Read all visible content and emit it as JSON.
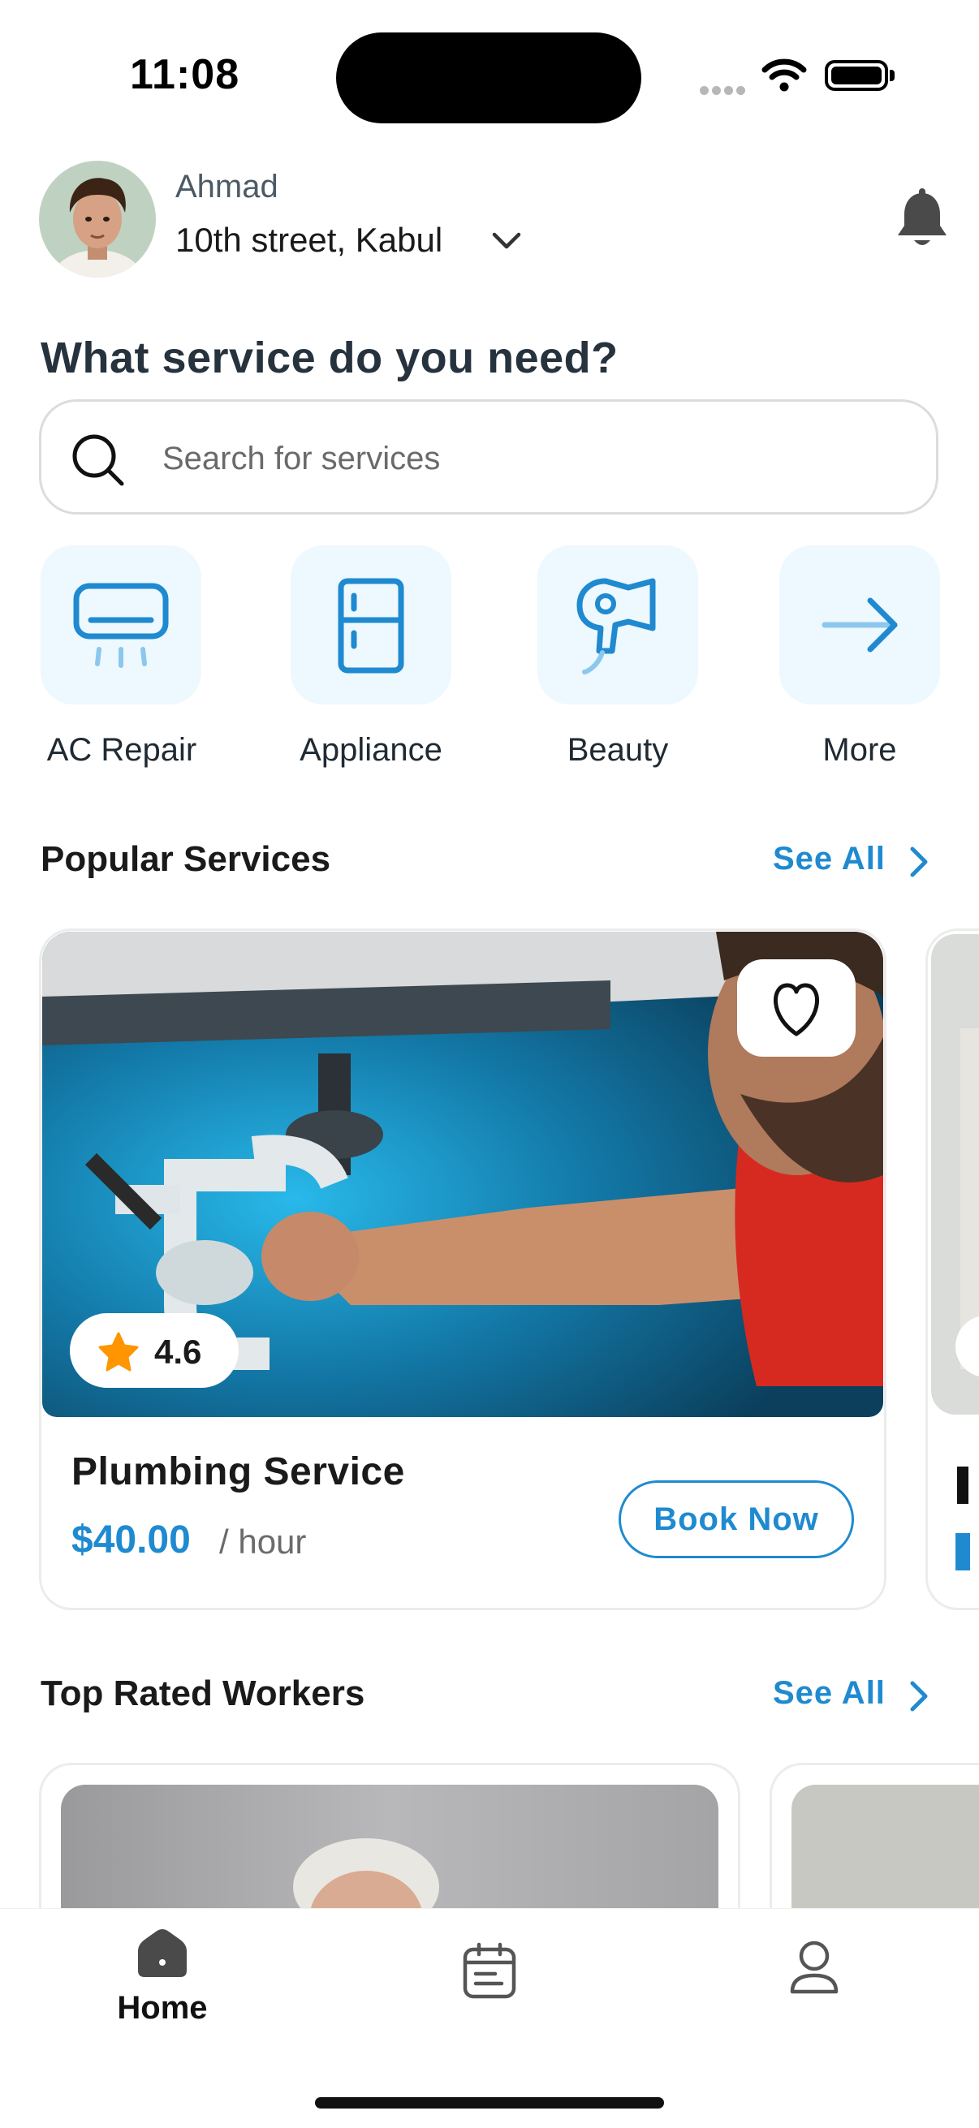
{
  "status_bar": {
    "time": "11:08"
  },
  "header": {
    "user_name": "Ahmad",
    "location": "10th street, Kabul"
  },
  "headline": "What service do you need?",
  "search": {
    "placeholder": "Search for services"
  },
  "categories": [
    {
      "label": "AC Repair",
      "icon": "ac-icon"
    },
    {
      "label": "Appliance",
      "icon": "fridge-icon"
    },
    {
      "label": "Beauty",
      "icon": "hair-dryer-icon"
    },
    {
      "label": "More",
      "icon": "arrow-right-icon"
    }
  ],
  "popular": {
    "title": "Popular Services",
    "see_all": "See All",
    "cards": [
      {
        "rating": "4.6",
        "name": "Plumbing Service",
        "price": "$40.00",
        "unit": "/ hour",
        "cta": "Book Now"
      }
    ]
  },
  "workers": {
    "title": "Top Rated Workers",
    "see_all": "See All"
  },
  "bottom_nav": {
    "home_label": "Home"
  },
  "colors": {
    "accent": "#1f8ad0",
    "tile_bg": "#eef8ff",
    "star": "#ff9500"
  }
}
